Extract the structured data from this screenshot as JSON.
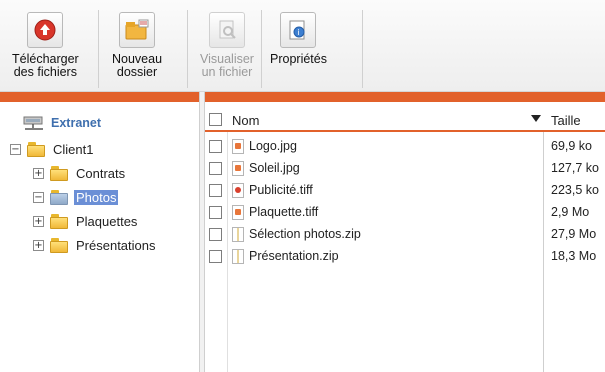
{
  "toolbar": {
    "buttons": [
      {
        "label": "Télécharger\ndes fichiers",
        "icon": "upload-icon",
        "enabled": true
      },
      {
        "label": "Nouveau\ndossier",
        "icon": "new-folder-icon",
        "enabled": true
      },
      {
        "label": "Visualiser\nun fichier",
        "icon": "view-file-icon",
        "enabled": false
      },
      {
        "label": "Propriétés",
        "icon": "properties-icon",
        "enabled": true
      }
    ]
  },
  "tree": {
    "root_label": "Extranet",
    "client": {
      "label": "Client1",
      "expanded": true
    },
    "folders": [
      {
        "label": "Contrats",
        "expanded": false,
        "selected": false
      },
      {
        "label": "Photos",
        "expanded": true,
        "selected": true
      },
      {
        "label": "Plaquettes",
        "expanded": false,
        "selected": false
      },
      {
        "label": "Présentations",
        "expanded": false,
        "selected": false
      }
    ]
  },
  "list": {
    "columns": {
      "name": "Nom",
      "size": "Taille"
    },
    "rows": [
      {
        "name": "Logo.jpg",
        "size": "69,9 ko",
        "type": "jpg"
      },
      {
        "name": "Soleil.jpg",
        "size": "127,7 ko",
        "type": "jpg"
      },
      {
        "name": "Publicité.tiff",
        "size": "223,5 ko",
        "type": "tiff"
      },
      {
        "name": "Plaquette.tiff",
        "size": "2,9 Mo",
        "type": "tiff"
      },
      {
        "name": "Sélection photos.zip",
        "size": "27,9 Mo",
        "type": "zip"
      },
      {
        "name": "Présentation.zip",
        "size": "18,3 Mo",
        "type": "zip"
      }
    ]
  },
  "colors": {
    "accent": "#e2612b",
    "selection": "#6b8fd6",
    "link": "#3f6fae"
  }
}
